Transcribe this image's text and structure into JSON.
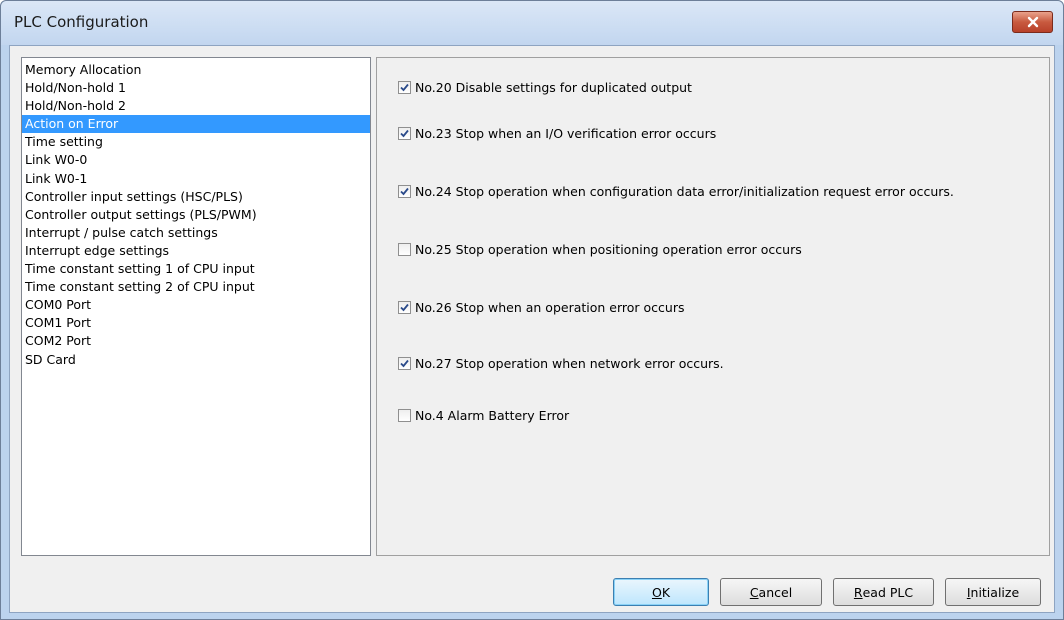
{
  "window": {
    "title": "PLC Configuration"
  },
  "nav": {
    "items": [
      {
        "label": "Memory Allocation"
      },
      {
        "label": "Hold/Non-hold 1"
      },
      {
        "label": "Hold/Non-hold 2"
      },
      {
        "label": "Action on Error",
        "selected": true
      },
      {
        "label": "Time setting"
      },
      {
        "label": "Link W0-0"
      },
      {
        "label": "Link W0-1"
      },
      {
        "label": "Controller input settings (HSC/PLS)"
      },
      {
        "label": "Controller output settings (PLS/PWM)"
      },
      {
        "label": "Interrupt / pulse catch settings"
      },
      {
        "label": "Interrupt edge settings"
      },
      {
        "label": "Time constant setting 1 of CPU input"
      },
      {
        "label": "Time constant setting 2 of CPU input"
      },
      {
        "label": "COM0 Port"
      },
      {
        "label": "COM1 Port"
      },
      {
        "label": "COM2 Port"
      },
      {
        "label": "SD Card"
      }
    ]
  },
  "options": [
    {
      "label": "No.20 Disable settings for duplicated output",
      "checked": true
    },
    {
      "label": "No.23 Stop when an I/O verification error occurs",
      "checked": true
    },
    {
      "label": "No.24 Stop operation when configuration data error/initialization request error occurs.",
      "checked": true
    },
    {
      "label": "No.25 Stop operation when positioning operation error occurs",
      "checked": false
    },
    {
      "label": "No.26 Stop when an operation error occurs",
      "checked": true
    },
    {
      "label": "No.27 Stop operation when network error occurs.",
      "checked": true
    },
    {
      "label": "No.4 Alarm Battery Error",
      "checked": false
    }
  ],
  "buttons": {
    "ok": {
      "mnemonic": "O",
      "rest": "K"
    },
    "cancel": {
      "mnemonic": "C",
      "rest": "ancel"
    },
    "read_plc": {
      "mnemonic": "R",
      "rest": "ead PLC"
    },
    "initialize": {
      "mnemonic": "I",
      "rest": "nitialize"
    }
  },
  "colors": {
    "selection": "#3399ff",
    "close_button": "#c85a3f",
    "check": "#2a4a8a"
  }
}
